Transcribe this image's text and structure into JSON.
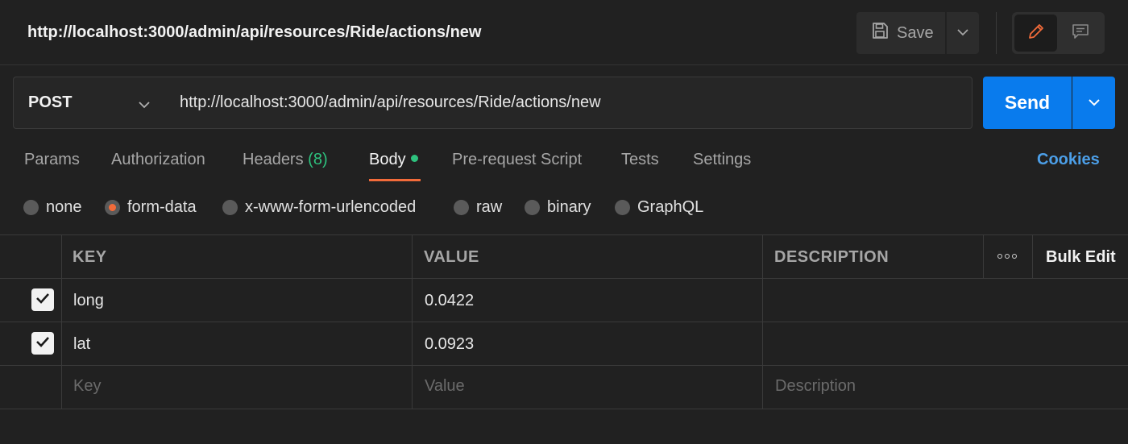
{
  "request": {
    "title": "http://localhost:3000/admin/api/resources/Ride/actions/new",
    "method": "POST",
    "url": "http://localhost:3000/admin/api/resources/Ride/actions/new"
  },
  "toolbar": {
    "save_label": "Save",
    "send_label": "Send"
  },
  "tabs": [
    {
      "label": "Params"
    },
    {
      "label": "Authorization"
    },
    {
      "label": "Headers",
      "count": "(8)"
    },
    {
      "label": "Body",
      "active": true,
      "has_dot": true
    },
    {
      "label": "Pre-request Script"
    },
    {
      "label": "Tests"
    },
    {
      "label": "Settings"
    }
  ],
  "cookies_label": "Cookies",
  "body_types": [
    {
      "label": "none",
      "selected": false
    },
    {
      "label": "form-data",
      "selected": true
    },
    {
      "label": "x-www-form-urlencoded",
      "selected": false
    },
    {
      "label": "raw",
      "selected": false
    },
    {
      "label": "binary",
      "selected": false
    },
    {
      "label": "GraphQL",
      "selected": false
    }
  ],
  "table": {
    "headers": {
      "key": "KEY",
      "value": "VALUE",
      "description": "DESCRIPTION"
    },
    "bulk_edit_label": "Bulk Edit",
    "rows": [
      {
        "checked": true,
        "key": "long",
        "value": "0.0422",
        "description": ""
      },
      {
        "checked": true,
        "key": "lat",
        "value": "0.0923",
        "description": ""
      }
    ],
    "placeholders": {
      "key": "Key",
      "value": "Value",
      "description": "Description"
    }
  },
  "colors": {
    "accent_orange": "#f26b3a",
    "send_blue": "#097bed",
    "active_green": "#2ec27e",
    "link_blue": "#4c9fe8"
  },
  "icons": [
    "save-icon",
    "chevron-down-icon",
    "pencil-icon",
    "comment-icon",
    "more-horizontal-icon",
    "checkmark-icon"
  ]
}
